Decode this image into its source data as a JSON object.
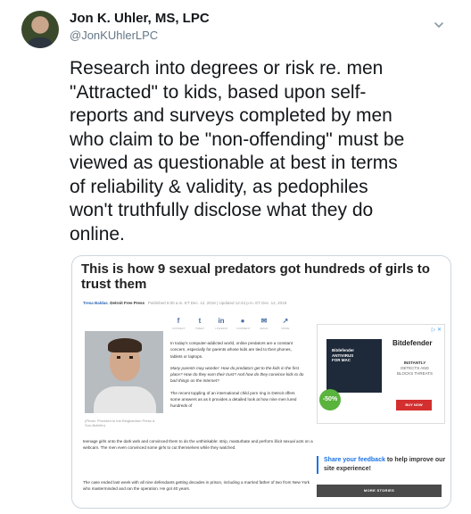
{
  "author": {
    "name": "Jon K. Uhler, MS, LPC",
    "handle": "@JonKUhlerLPC"
  },
  "tweet": {
    "lines": [
      "Research into degrees or risk re. men",
      "\"Attracted\" to kids, based upon self-",
      "reports and surveys completed by men",
      "who claim to be \"non-offending\" must be",
      "viewed as questionable at best in terms",
      "of reliability & validity, as pedophiles",
      "won't truthfully disclose what they do",
      "online."
    ]
  },
  "card": {
    "title": "This is how 9 sexual predators got hundreds of girls to trust them",
    "byline": {
      "author": "Tresa Baldas",
      "paper": "Detroit Free Press",
      "published": "Published 6:00 a.m. ET Dec. 12, 2018 | Updated 12:43 p.m. ET Dec. 12, 2018"
    },
    "shares": [
      {
        "icon": "f",
        "label": "CONNECT"
      },
      {
        "icon": "t",
        "label": "TWEET"
      },
      {
        "icon": "in",
        "label": "LINKEDIN"
      },
      {
        "icon": "●",
        "label": "COMMENT"
      },
      {
        "icon": "✉",
        "label": "EMAIL"
      },
      {
        "icon": "↗",
        "label": "MORE"
      }
    ],
    "photo_caption": "(Photo: Provided to the Binghamton Press & Sun-Bulletin)",
    "paragraphs": [
      "In today's computer-addicted world, online predators are a constant concern, especially for parents whose kids are tied to their phones, tablets or laptops.",
      "Many parents may wonder: How do predators get to the kids in the first place? How do they earn their trust? And how do they convince kids to do bad things on the Internet?",
      "The recent toppling of an international child porn ring in Detroit offers some answers as as it provides a detailed look at how nine men lured hundreds of",
      "teenage girls onto the dark web and convinced them to do the unthinkable: strip, masturbate and perform illicit sexual acts on a webcam. The men even convinced some girls to cut themselves while they watched.",
      "The case ended last week with all nine defendants getting decades in prison, including a married father of two from New York who masterminded and ran the operation. He got 40 years."
    ],
    "ad": {
      "choices": "▷ ✕",
      "brand": "Bitdefender",
      "box_text": "Bitdefender ANTIVIRUS FOR MAC",
      "discount": "-50%",
      "tagline_bold": "INSTANTLY",
      "tagline": "DETECTS AND BLOCKS THREATS",
      "buy": "BUY NOW"
    },
    "feedback": {
      "link": "Share your feedback",
      "rest": "to help improve our site experience!"
    },
    "more_stories": "MORE STORIES"
  },
  "colors": {
    "handle": "#657786",
    "link_blue": "#1a73e8",
    "border": "#ccd6dd"
  }
}
